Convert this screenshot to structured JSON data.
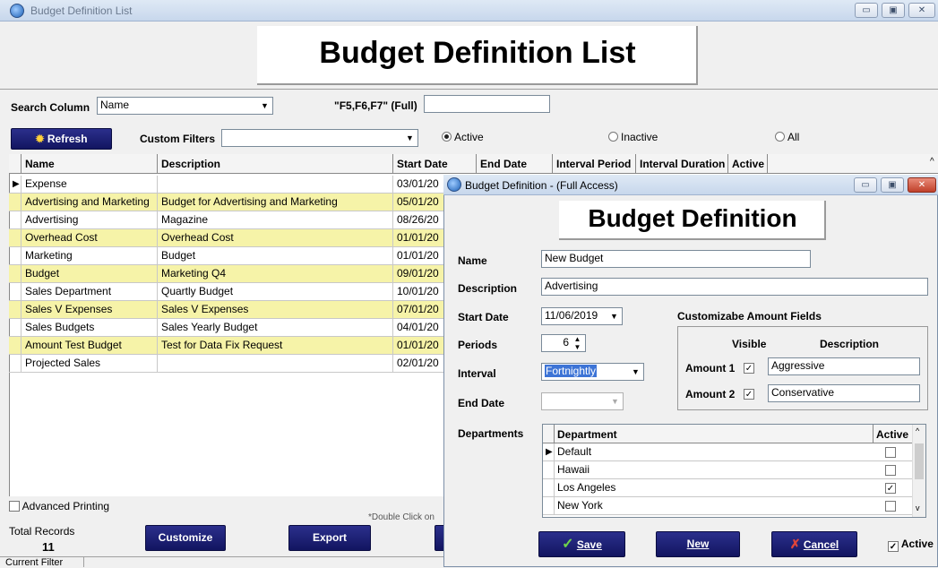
{
  "main_window": {
    "title": "Budget Definition List",
    "heading": "Budget Definition List",
    "search_column_label": "Search Column",
    "search_column_value": "Name",
    "search_hint": "\"F5,F6,F7\" (Full)",
    "search_value": "",
    "refresh_label": "Refresh",
    "custom_filters_label": "Custom Filters",
    "custom_filters_value": "",
    "radio_active": "Active",
    "radio_inactive": "Inactive",
    "radio_all": "All",
    "columns": [
      "Name",
      "Description",
      "Start Date",
      "End Date",
      "Interval Period",
      "Interval Duration",
      "Active"
    ],
    "rows": [
      {
        "name": "Expense",
        "description": "",
        "start": "03/01/20"
      },
      {
        "name": "Advertising and Marketing",
        "description": "Budget for Advertising and Marketing",
        "start": "05/01/20"
      },
      {
        "name": "Advertising",
        "description": "Magazine",
        "start": "08/26/20"
      },
      {
        "name": "Overhead Cost",
        "description": "Overhead Cost",
        "start": "01/01/20"
      },
      {
        "name": "Marketing",
        "description": "Budget",
        "start": "01/01/20"
      },
      {
        "name": "Budget",
        "description": "Marketing Q4",
        "start": "09/01/20"
      },
      {
        "name": "Sales Department",
        "description": "Quartly Budget",
        "start": "10/01/20"
      },
      {
        "name": "Sales V Expenses",
        "description": "Sales V Expenses",
        "start": "07/01/20"
      },
      {
        "name": "Sales Budgets",
        "description": "Sales Yearly Budget",
        "start": "04/01/20"
      },
      {
        "name": "Amount Test Budget",
        "description": "Test for Data Fix Request",
        "start": "01/01/20"
      },
      {
        "name": "Projected Sales",
        "description": "",
        "start": "02/01/20"
      }
    ],
    "advanced_printing_label": "Advanced Printing",
    "double_click_hint": "*Double Click on",
    "total_records_label": "Total Records",
    "total_records_value": "11",
    "customize_label": "Customize",
    "export_label": "Export",
    "current_filter_label": "Current Filter"
  },
  "dialog": {
    "title": "Budget Definition - (Full Access)",
    "heading": "Budget Definition",
    "name_label": "Name",
    "name_value": "New Budget",
    "description_label": "Description",
    "description_value": "Advertising",
    "start_date_label": "Start Date",
    "start_date_value": "11/06/2019",
    "periods_label": "Periods",
    "periods_value": "6",
    "interval_label": "Interval",
    "interval_value": "Fortnightly",
    "end_date_label": "End Date",
    "end_date_value": "",
    "custom_fields_label": "Customizabe Amount Fields",
    "visible_header": "Visible",
    "description_header": "Description",
    "amount1_label": "Amount 1",
    "amount1_checked": true,
    "amount1_value": "Aggressive",
    "amount2_label": "Amount 2",
    "amount2_checked": true,
    "amount2_value": "Conservative",
    "departments_label": "Departments",
    "dept_columns": [
      "Department",
      "Active"
    ],
    "departments": [
      {
        "name": "Default",
        "active": false
      },
      {
        "name": "Hawaii",
        "active": false
      },
      {
        "name": "Los Angeles",
        "active": true
      },
      {
        "name": "New York",
        "active": false
      }
    ],
    "save_label": "Save",
    "new_label": "New",
    "cancel_label": "Cancel",
    "active_label": "Active",
    "active_checked": true
  },
  "colors": {
    "row_highlight": "#f6f3a8",
    "button_navy": "#1b1e74",
    "selection_blue": "#3d74d6"
  }
}
